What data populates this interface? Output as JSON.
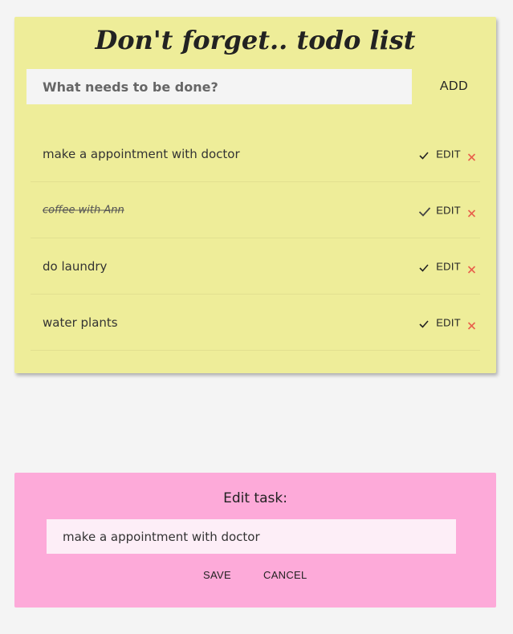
{
  "todo": {
    "title": "Don't forget.. todo list",
    "input_placeholder": "What needs to be done?",
    "add_label": "ADD",
    "items": [
      {
        "text": "make a appointment with doctor",
        "done": false,
        "edit_label": "EDIT"
      },
      {
        "text": "coffee with Ann",
        "done": true,
        "edit_label": "EDIT"
      },
      {
        "text": "do laundry",
        "done": false,
        "edit_label": "EDIT"
      },
      {
        "text": "water plants",
        "done": false,
        "edit_label": "EDIT"
      }
    ]
  },
  "edit_panel": {
    "title": "Edit task:",
    "input_value": "make a appointment with doctor",
    "save_label": "SAVE",
    "cancel_label": "CANCEL"
  },
  "colors": {
    "todo_card_bg": "#eeed99",
    "edit_card_bg": "#fdaad9",
    "delete_accent": "#e8604c",
    "page_bg": "#f4f4f4"
  },
  "icons": {
    "complete": "check-icon",
    "delete": "close-icon"
  }
}
